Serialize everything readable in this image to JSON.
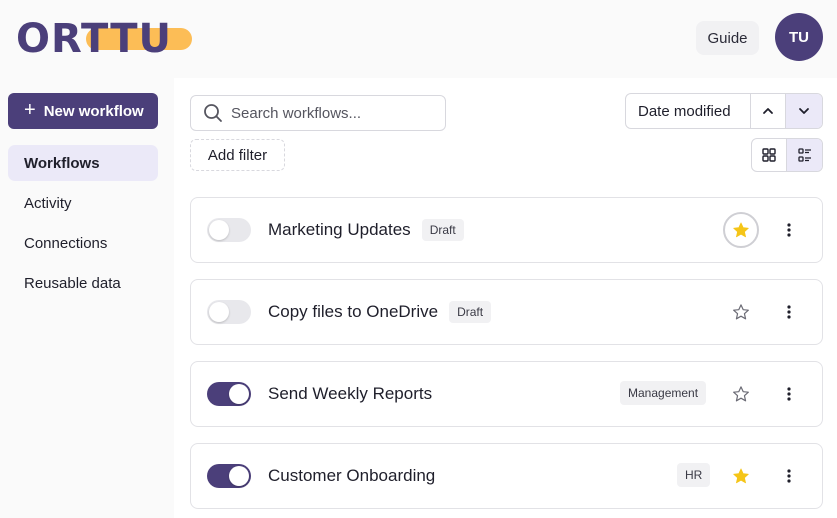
{
  "header": {
    "logo_text": "ORTTU",
    "guide_label": "Guide",
    "avatar_initials": "TU"
  },
  "sidebar": {
    "new_workflow_label": "New workflow",
    "items": [
      {
        "label": "Workflows",
        "active": true
      },
      {
        "label": "Activity",
        "active": false
      },
      {
        "label": "Connections",
        "active": false
      },
      {
        "label": "Reusable data",
        "active": false
      }
    ]
  },
  "toolbar": {
    "search_placeholder": "Search workflows...",
    "search_value": "",
    "add_filter_label": "Add filter",
    "sort_selected": "Date modified",
    "sort_direction": "descending",
    "view_mode": "list"
  },
  "workflows": [
    {
      "name": "Marketing Updates",
      "status_badge": "Draft",
      "enabled": false,
      "starred": true,
      "tag": ""
    },
    {
      "name": "Copy files to OneDrive",
      "status_badge": "Draft",
      "enabled": false,
      "starred": false,
      "tag": ""
    },
    {
      "name": "Send Weekly Reports",
      "status_badge": "",
      "enabled": true,
      "starred": false,
      "tag": "Management"
    },
    {
      "name": "Customer Onboarding",
      "status_badge": "",
      "enabled": true,
      "starred": true,
      "tag": "HR"
    }
  ],
  "colors": {
    "brand_primary": "#4b3f7a",
    "brand_accent": "#fcbd56",
    "star_active": "#f5c518",
    "active_nav_bg": "#ebe9f8"
  }
}
